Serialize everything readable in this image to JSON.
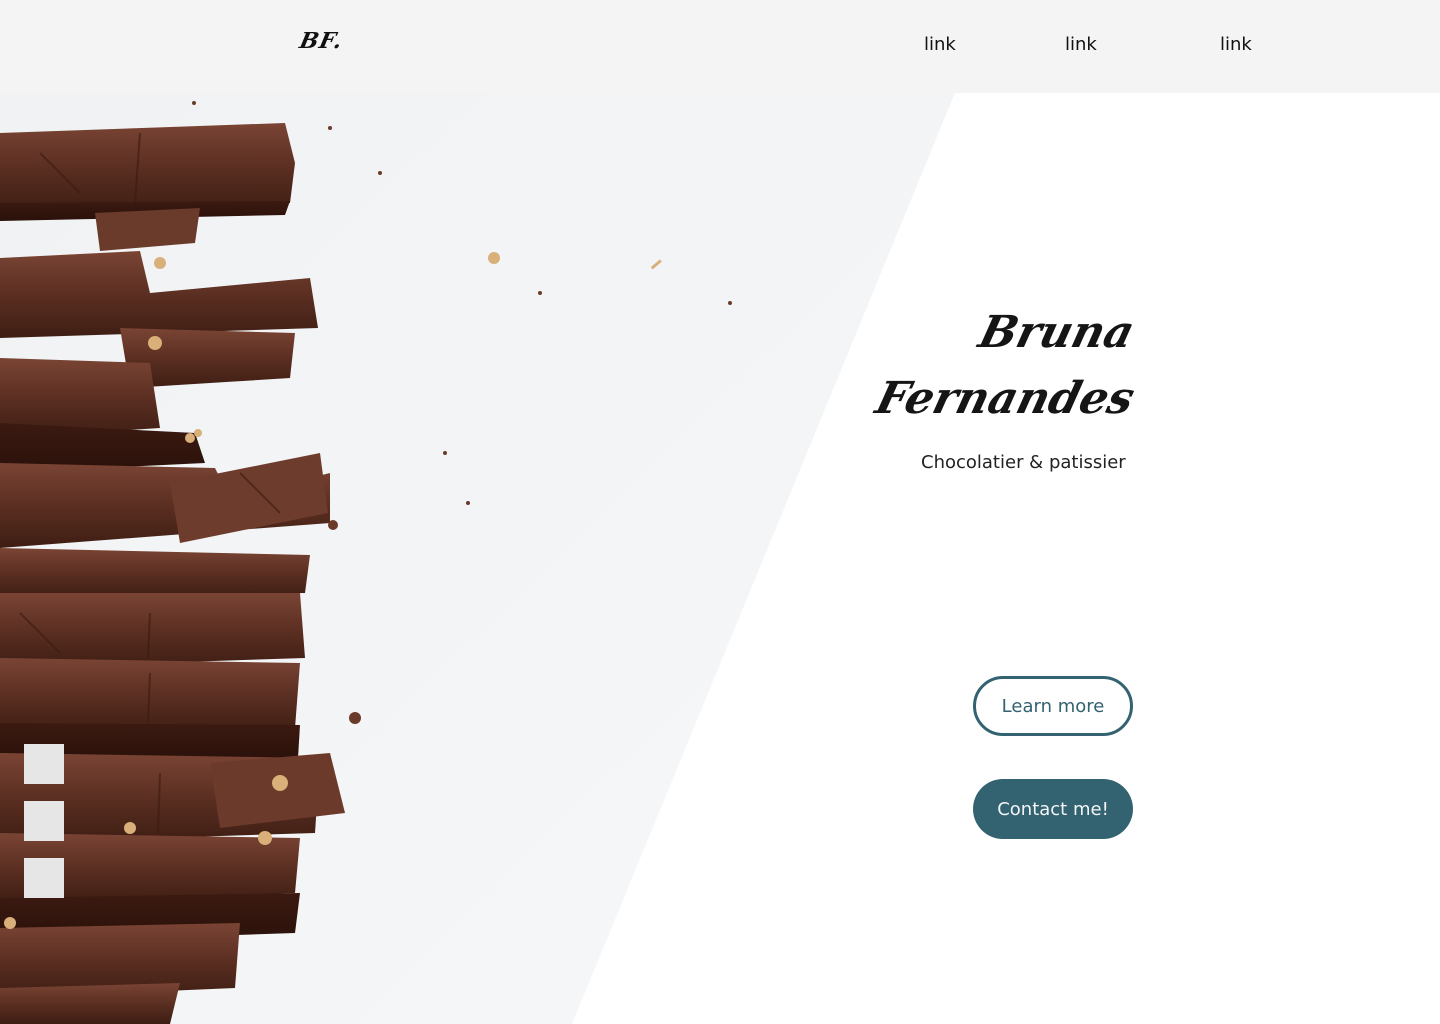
{
  "header": {
    "logo": "BF.",
    "links": [
      "link",
      "link",
      "link"
    ]
  },
  "hero": {
    "name_first": "Bruna",
    "name_last": "Fernandes",
    "subtitle": "Chocolatier & patissier",
    "buttons": {
      "learn_more": "Learn more",
      "contact": "Contact me!"
    }
  },
  "side_indicators": 3,
  "colors": {
    "accent": "#336271",
    "header_bg": "#f4f4f4",
    "image_bg": "#f3f5f7",
    "chocolate": "#5a2f22"
  }
}
